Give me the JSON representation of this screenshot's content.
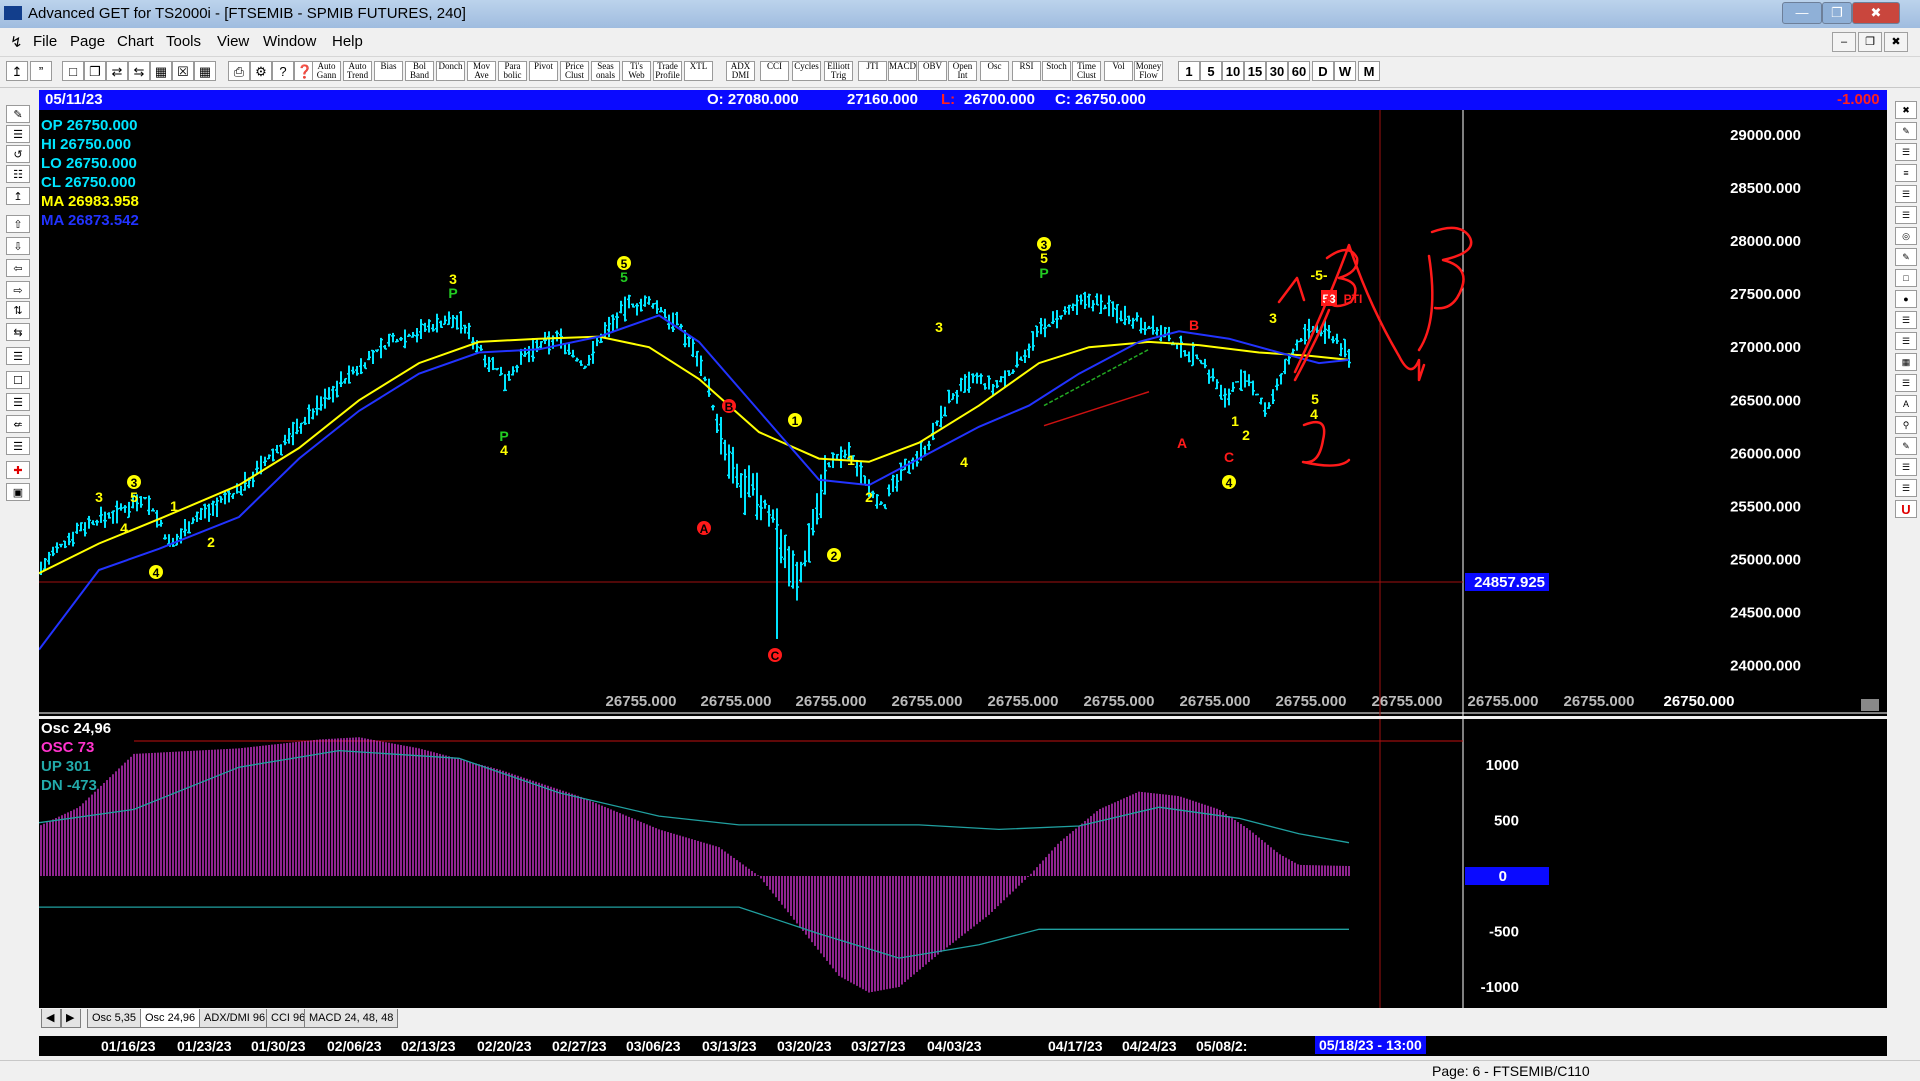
{
  "window": {
    "title": "Advanced GET for TS2000i - [FTSEMIB - SPMIB FUTURES, 240]"
  },
  "menu": [
    "File",
    "Page",
    "Chart",
    "Tools",
    "View",
    "Window",
    "Help"
  ],
  "toolbar": {
    "studies": [
      "Auto Gann",
      "Auto Trend",
      "Bias",
      "Bol Band",
      "Donch",
      "Mov Ave",
      "Para bolic",
      "Pivot",
      "Price Clust",
      "Seas onals",
      "Ti's Web",
      "Trade Profile",
      "XTL",
      "ADX DMI",
      "CCI",
      "Cycles",
      "Elliott Trig",
      "JTI",
      "MACD",
      "OBV",
      "Open Int",
      "Osc",
      "RSI",
      "Stoch",
      "Time Clust",
      "Vol",
      "Money Flow"
    ],
    "timeframes": [
      "1",
      "5",
      "10",
      "15",
      "30",
      "60",
      "D",
      "W",
      "M"
    ]
  },
  "header": {
    "date": "05/11/23",
    "open": "O: 27080.000",
    "high": "27160.000",
    "low_label": "L:",
    "low": "26700.000",
    "close": "C: 26750.000",
    "change": "-1.000"
  },
  "readout": [
    {
      "label": "OP 26750.000",
      "color": "#00e5ff"
    },
    {
      "label": "HI  26750.000",
      "color": "#00e5ff"
    },
    {
      "label": "LO  26750.000",
      "color": "#00e5ff"
    },
    {
      "label": "CL  26750.000",
      "color": "#00e5ff"
    },
    {
      "label": "MA  26983.958",
      "color": "#ffff00"
    },
    {
      "label": "MA  26873.542",
      "color": "#2233ff"
    }
  ],
  "price_axis": [
    "29000.000",
    "28500.000",
    "28000.000",
    "27500.000",
    "27000.000",
    "26500.000",
    "26000.000",
    "25500.000",
    "25000.000",
    "24500.000",
    "24000.000"
  ],
  "crosshair_price": "24857.925",
  "bottom_values": [
    "26755.000",
    "26755.000",
    "26755.000",
    "26755.000",
    "26755.000",
    "26755.000",
    "26755.000",
    "26755.000",
    "26755.000",
    "26755.000",
    "26755.000",
    "26750.000"
  ],
  "osc_readout": [
    {
      "label": "Osc 24,96",
      "color": "#ffffff"
    },
    {
      "label": "OSC 73",
      "color": "#ff33cc"
    },
    {
      "label": "UP   301",
      "color": "#22aaaa"
    },
    {
      "label": "DN  -473",
      "color": "#22aaaa"
    }
  ],
  "osc_axis": [
    "1000",
    "500",
    "0",
    "-500",
    "-1000"
  ],
  "tabs": [
    "Osc 5,35",
    "Osc 24,96",
    "ADX/DMI 96",
    "CCI 96",
    "MACD 24, 48, 48"
  ],
  "dates": [
    "01/16/23",
    "01/23/23",
    "01/30/23",
    "02/06/23",
    "02/13/23",
    "02/20/23",
    "02/27/23",
    "03/06/23",
    "03/13/23",
    "03/20/23",
    "03/27/23",
    "04/03/23",
    "04/17/23",
    "04/24/23",
    "05/08/2:"
  ],
  "date_cursor": "05/18/23 - 13:00",
  "status": {
    "page": "Page: 6 - FTSEMIB/C110"
  },
  "wave_labels": {
    "three": "3",
    "five": "5",
    "four": "4",
    "one": "1",
    "two": "2",
    "P": "P",
    "A": "A",
    "B": "B",
    "C": "C",
    "one_c": "1",
    "neg5": "-5-",
    "pti": "53",
    "pti_text": "PTI"
  },
  "colors": {
    "bars": "#00e5ff",
    "ma_fast": "#ffff00",
    "ma_slow": "#2233ff",
    "osc": "#cc33cc",
    "osc_line": "#20a0a0",
    "wave": "#ffff00",
    "pivot": "#22cc22",
    "abc": "#ff1a1a",
    "bg": "#000000"
  }
}
